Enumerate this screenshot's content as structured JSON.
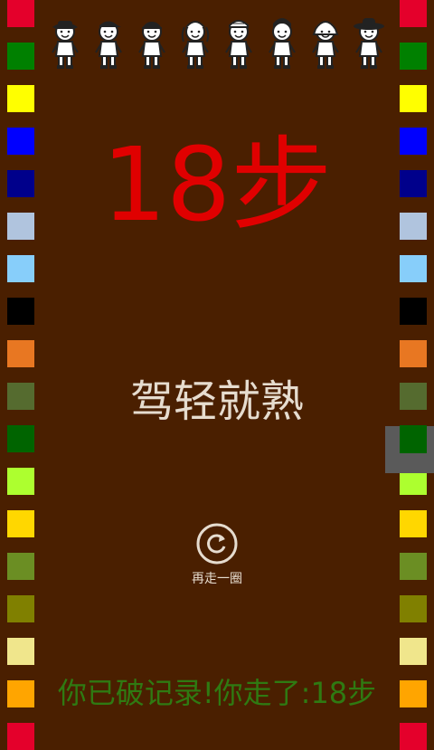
{
  "left_swatches": [
    "#e4002b",
    "#008000",
    "#ffff00",
    "#0000ff",
    "#00008b",
    "#b0c4de",
    "#87cefa",
    "#000000",
    "#e87722",
    "#556b2f",
    "#006400",
    "#adff2f",
    "#ffd700",
    "#6b8e23",
    "#808000",
    "#f0e68c",
    "#ffa500",
    "#e4002b"
  ],
  "right_swatches": [
    "#e4002b",
    "#008000",
    "#ffff00",
    "#0000ff",
    "#00008b",
    "#b0c4de",
    "#87cefa",
    "#000000",
    "#e87722",
    "#556b2f",
    "#006400",
    "#adff2f",
    "#ffd700",
    "#6b8e23",
    "#808000",
    "#f0e68c",
    "#ffa500",
    "#e4002b"
  ],
  "characters": [
    "cowboy-boy-icon",
    "cap-boy-icon",
    "helmet-boy-icon",
    "pigtail-girl-icon",
    "bandana-boy-icon",
    "ponytail-girl-icon",
    "headscarf-girl-icon",
    "sunhat-boy-icon"
  ],
  "result": {
    "steps_text": "18步",
    "rank_text": "驾轻就熟"
  },
  "replay": {
    "label": "再走一圈",
    "icon": "replay-icon"
  },
  "record_message": "你已破记录!你走了:18步",
  "colors": {
    "background": "#4a1f00",
    "steps": "#e00000",
    "rank": "#e6dccf",
    "record": "#2f7a12"
  }
}
